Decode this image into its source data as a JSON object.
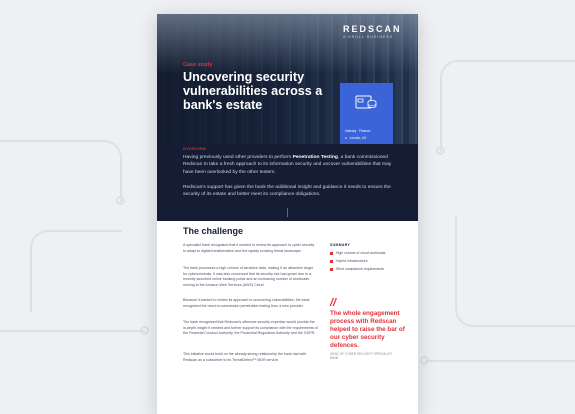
{
  "hero": {
    "logo": "REDSCAN",
    "logo_sub": "A KROLL BUSINESS",
    "kicker": "Case study",
    "title": "Uncovering security vulnerabilities across a bank's estate",
    "info": {
      "sector_label": "Industry",
      "sector_value": "Finance",
      "location_value": "London, UK"
    }
  },
  "overview": {
    "heading": "OVERVIEW",
    "p1_pre": "Having previously used other providers to perform ",
    "p1_bold": "Penetration Testing",
    "p1_post": ", a bank commissioned Redscan to take a fresh approach to its information security and uncover vulnerabilities that may have been overlooked by the other testers.",
    "p2": "Redscan's support has given the bank the additional insight and guidance it needs to ensure the security of its estate and better meet its compliance obligations."
  },
  "challenge": {
    "heading": "The challenge",
    "paragraphs": [
      "A specialist bank recognised that it needed to review its approach to cyber security to adapt to digital transformation and the rapidly evolving threat landscape.",
      "The bank processes a high volume of sensitive data, making it an attractive target for cybercriminals. It was also concerned that its security risk had grown due to a recently launched online banking portal and an increasing number of workloads moving to the Amazon Web Services (AWS) Cloud.",
      "Because it wanted to review its approach to uncovering vulnerabilities, the bank recognised the need to commission penetration testing from a new provider.",
      "The bank recognised that Redscan's offensive security expertise would provide the in-depth insight it needed and further support its compliance with the requirements of the Financial Conduct Authority, the Prudential Regulation Authority and the GDPR.",
      "This initiative would build on the already strong relationship the bank had with Redscan as a subscriber to its ThreatDetect™ MDR service."
    ]
  },
  "summary": {
    "heading": "SUMMARY",
    "items": [
      "High volume of cloud workloads",
      "Hybrid infrastructure",
      "Strict compliance requirements"
    ]
  },
  "quote": {
    "mark": "//",
    "text": "The whole engagement process with Redscan helped to raise the bar of our cyber security defences.",
    "attribution": "HEAD OF CYBER SECURITY SPECIALIST BANK"
  },
  "colors": {
    "accent": "#e0323a",
    "navy": "#141d33",
    "blue": "#3a64d8",
    "background": "#eef0f3"
  }
}
